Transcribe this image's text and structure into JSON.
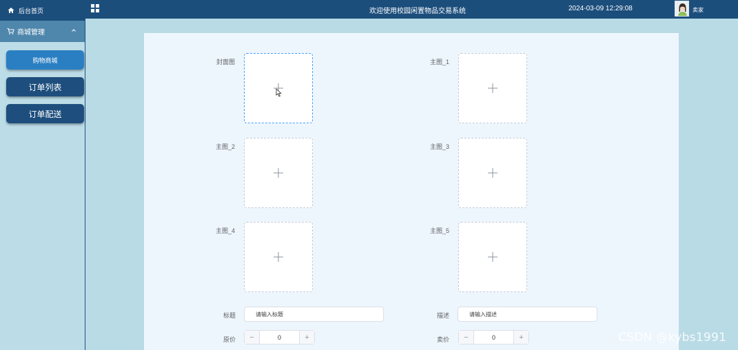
{
  "sidebar": {
    "home_label": "后台首页",
    "group_label": "商城管理",
    "items": [
      {
        "label": "购物商城",
        "active": true
      },
      {
        "label": "订单列表",
        "active": false
      },
      {
        "label": "订单配送",
        "active": false
      }
    ]
  },
  "header": {
    "title": "欢迎使用校园闲置物品交易系统",
    "datetime": "2024-03-09 12:29:08",
    "user": "卖家",
    "menu_icon": "grid-icon"
  },
  "form": {
    "uploads": {
      "cover": "封面图",
      "main1": "主图_1",
      "main2": "主图_2",
      "main3": "主图_3",
      "main4": "主图_4",
      "main5": "主图_5"
    },
    "title": {
      "label": "标题",
      "placeholder": "请输入标题"
    },
    "description": {
      "label": "描述",
      "placeholder": "请输入描述"
    },
    "original_price": {
      "label": "原价",
      "value": "0",
      "minus": "−",
      "plus": "+"
    },
    "sale_price": {
      "label": "卖价",
      "value": "0",
      "minus": "−",
      "plus": "+"
    }
  },
  "watermark": "CSDN @kybs1991",
  "colors": {
    "header_bg": "#1c4e7c",
    "active_item": "#2a7fc2",
    "page_bg": "#b9dbe6",
    "panel_bg": "#eef6fd",
    "focus_border": "#409eff"
  }
}
